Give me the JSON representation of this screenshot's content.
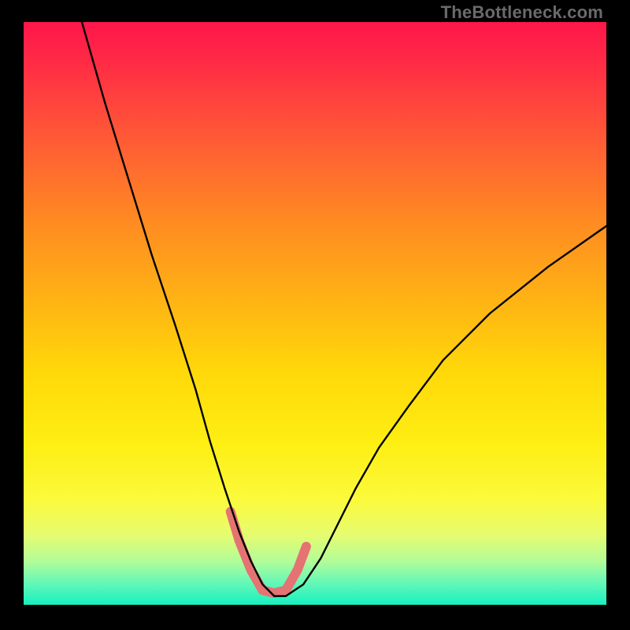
{
  "watermark": {
    "text": "TheBottleneck.com"
  },
  "chart_data": {
    "type": "line",
    "title": "",
    "xlabel": "",
    "ylabel": "",
    "xlim": [
      0,
      100
    ],
    "ylim": [
      0,
      100
    ],
    "grid": false,
    "legend": false,
    "background_gradient": {
      "top_color": "#ff164a",
      "bottom_color": "#16f0c0",
      "stops": [
        {
          "pos": 0.0,
          "color": "#ff164a"
        },
        {
          "pos": 0.6,
          "color": "#ffd80a"
        },
        {
          "pos": 0.82,
          "color": "#fbfa3c"
        },
        {
          "pos": 1.0,
          "color": "#16f0c0"
        }
      ]
    },
    "series": [
      {
        "name": "bottleneck-curve",
        "stroke": "#000000",
        "stroke_width": 2.4,
        "x": [
          10,
          14,
          18,
          22,
          26,
          29.5,
          32,
          34.5,
          37,
          39,
          41,
          43,
          45,
          48,
          51,
          54,
          57,
          61,
          66,
          72,
          80,
          90,
          100
        ],
        "y": [
          100,
          86,
          73,
          60,
          48,
          37,
          28,
          20,
          12.5,
          7.5,
          3.5,
          1.5,
          1.5,
          3.5,
          8,
          14,
          20,
          27,
          34,
          42,
          50,
          58,
          65
        ]
      },
      {
        "name": "highlight-band",
        "stroke": "#e57373",
        "stroke_width": 12,
        "x": [
          35.5,
          37,
          39,
          41,
          43,
          45,
          47,
          48.5
        ],
        "y": [
          16,
          11,
          6,
          2.5,
          2,
          2.5,
          6,
          10
        ]
      }
    ]
  }
}
